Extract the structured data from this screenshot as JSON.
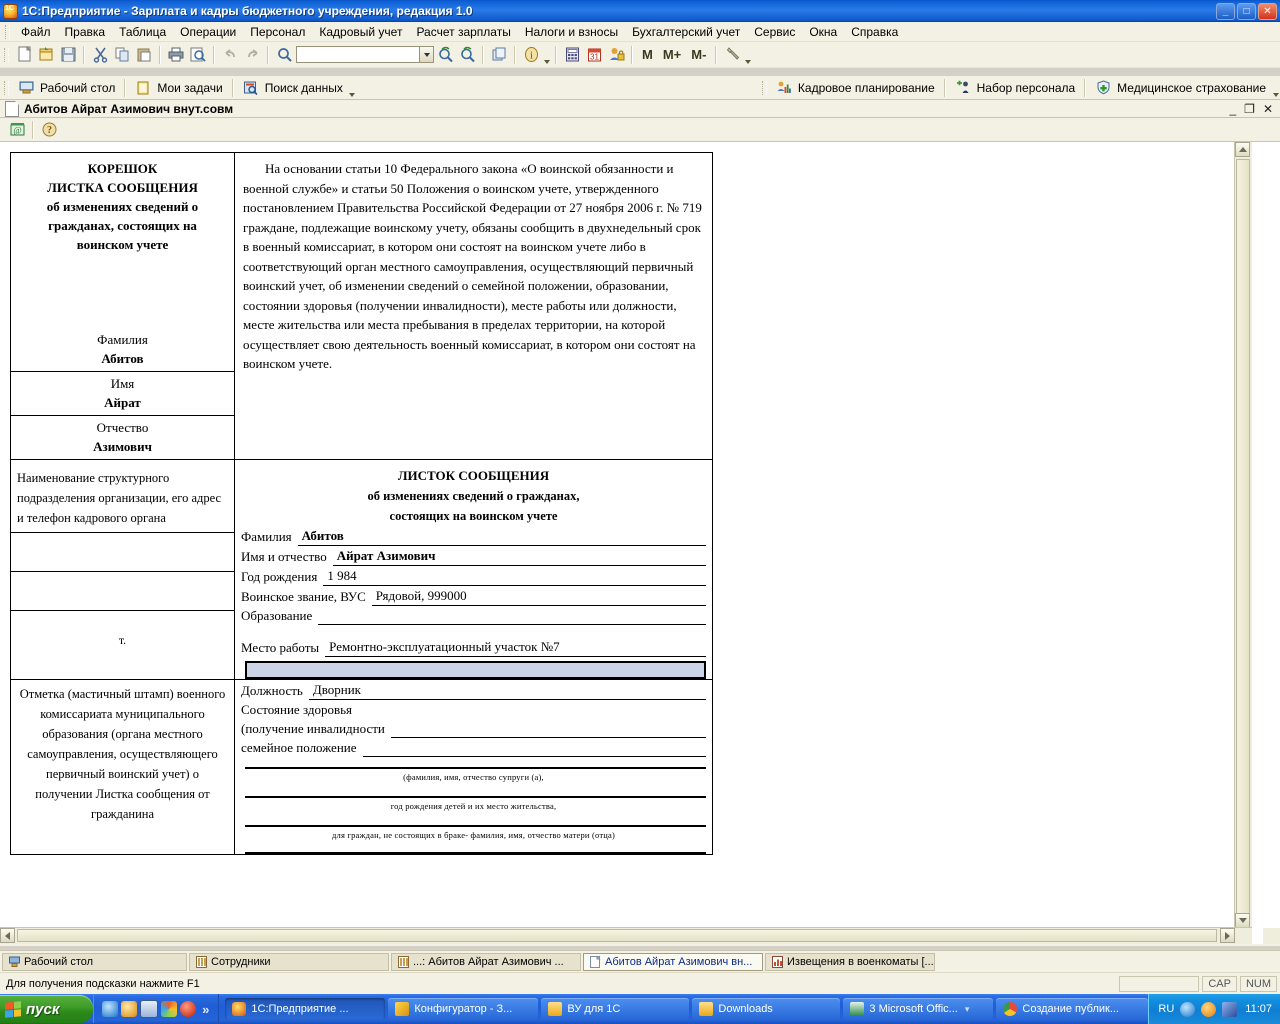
{
  "window": {
    "title": "1С:Предприятие - Зарплата и кадры бюджетного учреждения, редакция 1.0",
    "minimize": "_",
    "maximize": "□",
    "close": "✕"
  },
  "menu": {
    "items": [
      {
        "label": "Файл"
      },
      {
        "label": "Правка"
      },
      {
        "label": "Таблица"
      },
      {
        "label": "Операции"
      },
      {
        "label": "Персонал"
      },
      {
        "label": "Кадровый учет"
      },
      {
        "label": "Расчет зарплаты"
      },
      {
        "label": "Налоги и взносы"
      },
      {
        "label": "Бухгалтерский учет"
      },
      {
        "label": "Сервис"
      },
      {
        "label": "Окна"
      },
      {
        "label": "Справка"
      }
    ]
  },
  "toolbar": {
    "search_value": "",
    "search_placeholder": "",
    "memory_buttons": [
      "M",
      "M+",
      "M-"
    ],
    "shortcuts": [
      {
        "label": "Рабочий стол",
        "icon": "desktop-icon"
      },
      {
        "label": "Мои задачи",
        "icon": "tasks-icon"
      },
      {
        "label": "Поиск данных",
        "icon": "search-data-icon"
      }
    ],
    "right_shortcuts": [
      {
        "label": "Кадровое планирование",
        "icon": "hr-planning-icon"
      },
      {
        "label": "Набор персонала",
        "icon": "recruiting-icon"
      },
      {
        "label": "Медицинское страхование",
        "icon": "medical-insurance-icon"
      }
    ]
  },
  "child_window": {
    "title": "Абитов Айрат Азимович  внут.совм",
    "minimize": "_",
    "restore": "❐",
    "close": "✕"
  },
  "document": {
    "korshok": {
      "line1": "КОРЕШОК",
      "line2": "ЛИСТКА СООБЩЕНИЯ",
      "line3": "об изменениях сведений о",
      "line4": "гражданах, состоящих на",
      "line5": "воинском учете",
      "fields": [
        {
          "label": "Фамилия",
          "value": "Абитов"
        },
        {
          "label": "Имя",
          "value": "Айрат"
        },
        {
          "label": "Отчество",
          "value": "Азимович"
        }
      ]
    },
    "left_desc": "Наименование структурного подразделения организации, его адрес и телефон кадрового органа",
    "phone_label": "т.",
    "stamp_note": "Отметка (мастичный штамп) военного комиссариата муниципального образования (органа местного самоуправления, осуществляющего первичный воинский учет) о получении Листка сообщения от гражданина",
    "legal_paragraph": "На основании статьи 10 Федерального закона «О воинской обязанности и военной службе» и статьи 50 Положения о воинском учете, утвержденного постановлением Правительства Российской Федерации от 27 ноября 2006 г. № 719 граждане, подлежащие воинскому учету, обязаны сообщить в двухнедельный срок в военный комиссариат, в котором они состоят на воинском учете либо в соответствующий орган местного самоуправления, осуществляющий первичный воинский учет, об изменении сведений о семейной положении, образовании, состоянии здоровья (получении инвалидности), месте работы или должности, месте жительства или места пребывания в пределах территории, на которой осуществляет свою деятельность военный комиссариат, в котором они состоят на воинском учете.",
    "form_title": {
      "line1": "ЛИСТОК СООБЩЕНИЯ",
      "line2": "об изменениях сведений о гражданах,",
      "line3": "состоящих на воинском учете"
    },
    "fields": [
      {
        "label": "Фамилия",
        "value": "Абитов",
        "bold": true
      },
      {
        "label": "Имя и отчество",
        "value": "Айрат Азимович",
        "bold": true
      },
      {
        "label": "Год рождения",
        "value": "1 984",
        "bold": false
      },
      {
        "label": "Воинское звание, ВУС",
        "value": "Рядовой, 999000",
        "bold": false
      },
      {
        "label": "Образование",
        "value": "",
        "bold": false
      }
    ],
    "work_field": {
      "label": "Место работы",
      "value": "Ремонтно-эксплуатационный участок №7"
    },
    "selected_cell_value": "",
    "fields2": [
      {
        "label": "Должность",
        "value": "Дворник"
      },
      {
        "label": "Состояние здоровья",
        "value": ""
      },
      {
        "label": "(получение инвалидности",
        "value": ""
      },
      {
        "label": "семейное положение",
        "value": ""
      }
    ],
    "footnotes": [
      "(фамилия, имя, отчество супруги (а),",
      "год рождения детей и их место жительства,",
      "для граждан, не состоящих в браке- фамилия, имя, отчество матери (отца)"
    ]
  },
  "window_tabs": [
    {
      "label": "Рабочий стол",
      "icon": "desktop-icon",
      "active": false
    },
    {
      "label": "Сотрудники",
      "icon": "list-icon",
      "active": false
    },
    {
      "label": "...: Абитов Айрат Азимович ...",
      "icon": "list-icon",
      "active": false
    },
    {
      "label": "Абитов Айрат Азимович  вн...",
      "icon": "doc-icon",
      "active": true
    },
    {
      "label": "Извещения в военкоматы [...",
      "icon": "report-icon",
      "active": false
    }
  ],
  "statusbar": {
    "message": "Для получения подсказки нажмите F1",
    "caps": "CAP",
    "num": "NUM"
  },
  "taskbar": {
    "start_label": "пуск",
    "quicklaunch_more": "»",
    "tasks": [
      {
        "label": "1С:Предприятие ...",
        "icon": "onec-icon",
        "active": true,
        "dropdown": ""
      },
      {
        "label": "Конфигуратор - З...",
        "icon": "configurator-icon",
        "active": false,
        "dropdown": ""
      },
      {
        "label": "ВУ для 1С",
        "icon": "folder-icon",
        "active": false,
        "dropdown": ""
      },
      {
        "label": "Downloads",
        "icon": "folder-icon",
        "active": false,
        "dropdown": ""
      },
      {
        "label": "3 Microsoft Offic...",
        "icon": "excel-icon",
        "active": false,
        "dropdown": "▾"
      },
      {
        "label": "Создание публик...",
        "icon": "chrome-icon",
        "active": false,
        "dropdown": ""
      }
    ],
    "tray": {
      "language": "RU",
      "clock": "11:07"
    }
  },
  "colors": {
    "title_blue": "#1063d8",
    "toolbar_bg": "#f3f1e4",
    "selection_blue": "#ccd4e8",
    "taskbar_blue": "#2463d8",
    "start_green": "#3d9b27"
  }
}
